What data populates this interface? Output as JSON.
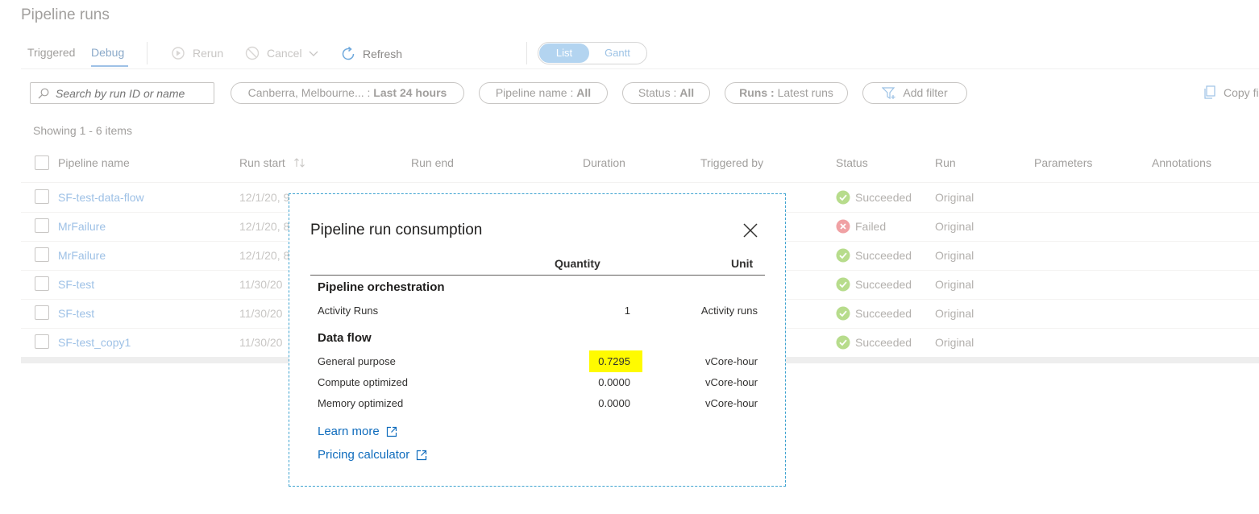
{
  "page": {
    "title": "Pipeline runs"
  },
  "toolbar": {
    "tabs": [
      "Triggered",
      "Debug"
    ],
    "rerun": "Rerun",
    "cancel": "Cancel",
    "refresh": "Refresh",
    "view_list": "List",
    "view_gantt": "Gantt"
  },
  "filters": {
    "search_placeholder": "Search by run ID or name",
    "timezone_label": "Canberra, Melbourne... :",
    "timezone_value": "Last 24 hours",
    "pipeline_label": "Pipeline name :",
    "pipeline_value": "All",
    "status_label": "Status :",
    "status_value": "All",
    "runs_label": "Runs :",
    "runs_value": "Latest runs",
    "add_filter": "Add filter",
    "copy_filter": "Copy fi"
  },
  "table": {
    "showing": "Showing 1 - 6 items",
    "headers": [
      "Pipeline name",
      "Run start",
      "Run end",
      "Duration",
      "Triggered by",
      "Status",
      "Run",
      "Parameters",
      "Annotations"
    ],
    "rows": [
      {
        "name": "SF-test-data-flow",
        "start": "12/1/20, 9",
        "status": "Succeeded",
        "run": "Original"
      },
      {
        "name": "MrFailure",
        "start": "12/1/20, 8",
        "status": "Failed",
        "run": "Original"
      },
      {
        "name": "MrFailure",
        "start": "12/1/20, 8",
        "status": "Succeeded",
        "run": "Original"
      },
      {
        "name": "SF-test",
        "start": "11/30/20",
        "status": "Succeeded",
        "run": "Original"
      },
      {
        "name": "SF-test",
        "start": "11/30/20",
        "status": "Succeeded",
        "run": "Original"
      },
      {
        "name": "SF-test_copy1",
        "start": "11/30/20",
        "status": "Succeeded",
        "run": "Original"
      }
    ]
  },
  "dialog": {
    "title": "Pipeline run consumption",
    "col_quantity": "Quantity",
    "col_unit": "Unit",
    "section_orchestration": "Pipeline orchestration",
    "section_dataflow": "Data flow",
    "rows": [
      {
        "label": "Activity Runs",
        "quantity": "1",
        "unit": "Activity runs"
      },
      {
        "label": "General purpose",
        "quantity": "0.7295",
        "unit": "vCore-hour"
      },
      {
        "label": "Compute optimized",
        "quantity": "0.0000",
        "unit": "vCore-hour"
      },
      {
        "label": "Memory optimized",
        "quantity": "0.0000",
        "unit": "vCore-hour"
      }
    ],
    "learn_more": "Learn more",
    "pricing_calculator": "Pricing calculator",
    "highlight_color": "#fffb00"
  },
  "colors": {
    "link": "#0f6cbd",
    "success": "#6bb700",
    "failure": "#d13438"
  }
}
